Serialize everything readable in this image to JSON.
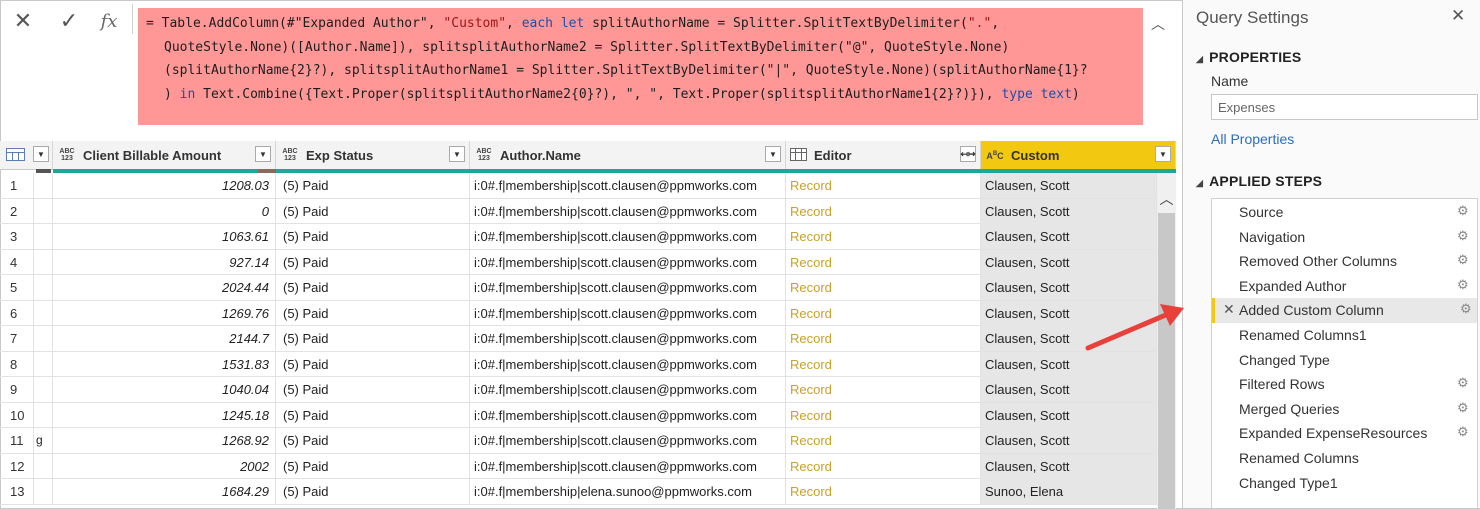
{
  "formula_bar": {
    "cancel_icon": "close-icon",
    "commit_icon": "check-icon",
    "fx_label": "fx",
    "line1_a": "= Table.AddColumn(#\"Expanded Author\", ",
    "line1_b": "\"Custom\"",
    "line1_c": ", ",
    "line1_d": "each let",
    "line1_e": " splitAuthorName = Splitter.SplitTextByDelimiter(",
    "line1_f": "\".\"",
    "line1_g": ",",
    "line2": "QuoteStyle.None)([Author.Name]), splitsplitAuthorName2 = Splitter.SplitTextByDelimiter(\"@\", QuoteStyle.None)",
    "line3": "(splitAuthorName{2}?), splitsplitAuthorName1 = Splitter.SplitTextByDelimiter(\"|\", QuoteStyle.None)(splitAuthorName{1}?",
    "line4_a": ") ",
    "line4_b": "in",
    "line4_c": " Text.Combine({Text.Proper(splitsplitAuthorName2{0}?), \", \", Text.Proper(splitsplitAuthorName1{2}?)}), ",
    "line4_d": "type text",
    "line4_e": ")",
    "bg_color": "#ff9797"
  },
  "grid": {
    "columns": [
      {
        "type_icon": "ABC\n123",
        "label": "Client Billable Amount"
      },
      {
        "type_icon": "ABC\n123",
        "label": "Exp Status"
      },
      {
        "type_icon": "ABC\n123",
        "label": "Author.Name"
      },
      {
        "type_icon": "table-icon",
        "label": "Editor"
      },
      {
        "type_icon": "ABC",
        "label": "Custom"
      }
    ],
    "rows": [
      {
        "n": "1",
        "sel": "",
        "amount": "1208.03",
        "status": "(5) Paid",
        "author": "i:0#.f|membership|scott.clausen@ppmworks.com",
        "editor": "Record",
        "custom": "Clausen, Scott"
      },
      {
        "n": "2",
        "sel": "",
        "amount": "0",
        "status": "(5) Paid",
        "author": "i:0#.f|membership|scott.clausen@ppmworks.com",
        "editor": "Record",
        "custom": "Clausen, Scott"
      },
      {
        "n": "3",
        "sel": "",
        "amount": "1063.61",
        "status": "(5) Paid",
        "author": "i:0#.f|membership|scott.clausen@ppmworks.com",
        "editor": "Record",
        "custom": "Clausen, Scott"
      },
      {
        "n": "4",
        "sel": "",
        "amount": "927.14",
        "status": "(5) Paid",
        "author": "i:0#.f|membership|scott.clausen@ppmworks.com",
        "editor": "Record",
        "custom": "Clausen, Scott"
      },
      {
        "n": "5",
        "sel": "",
        "amount": "2024.44",
        "status": "(5) Paid",
        "author": "i:0#.f|membership|scott.clausen@ppmworks.com",
        "editor": "Record",
        "custom": "Clausen, Scott"
      },
      {
        "n": "6",
        "sel": "",
        "amount": "1269.76",
        "status": "(5) Paid",
        "author": "i:0#.f|membership|scott.clausen@ppmworks.com",
        "editor": "Record",
        "custom": "Clausen, Scott"
      },
      {
        "n": "7",
        "sel": "",
        "amount": "2144.7",
        "status": "(5) Paid",
        "author": "i:0#.f|membership|scott.clausen@ppmworks.com",
        "editor": "Record",
        "custom": "Clausen, Scott"
      },
      {
        "n": "8",
        "sel": "",
        "amount": "1531.83",
        "status": "(5) Paid",
        "author": "i:0#.f|membership|scott.clausen@ppmworks.com",
        "editor": "Record",
        "custom": "Clausen, Scott"
      },
      {
        "n": "9",
        "sel": "",
        "amount": "1040.04",
        "status": "(5) Paid",
        "author": "i:0#.f|membership|scott.clausen@ppmworks.com",
        "editor": "Record",
        "custom": "Clausen, Scott"
      },
      {
        "n": "10",
        "sel": "",
        "amount": "1245.18",
        "status": "(5) Paid",
        "author": "i:0#.f|membership|scott.clausen@ppmworks.com",
        "editor": "Record",
        "custom": "Clausen, Scott"
      },
      {
        "n": "11",
        "sel": "g",
        "amount": "1268.92",
        "status": "(5) Paid",
        "author": "i:0#.f|membership|scott.clausen@ppmworks.com",
        "editor": "Record",
        "custom": "Clausen, Scott"
      },
      {
        "n": "12",
        "sel": "",
        "amount": "2002",
        "status": "(5) Paid",
        "author": "i:0#.f|membership|scott.clausen@ppmworks.com",
        "editor": "Record",
        "custom": "Clausen, Scott"
      },
      {
        "n": "13",
        "sel": "",
        "amount": "1684.29",
        "status": "(5) Paid",
        "author": "i:0#.f|membership|elena.sunoo@ppmworks.com",
        "editor": "Record",
        "custom": "Sunoo, Elena"
      }
    ]
  },
  "query_settings": {
    "title": "Query Settings",
    "properties_header": "PROPERTIES",
    "name_label": "Name",
    "name_value": "Expenses",
    "all_properties_link": "All Properties",
    "applied_steps_header": "APPLIED STEPS",
    "steps": [
      {
        "label": "Source",
        "gear": true
      },
      {
        "label": "Navigation",
        "gear": true
      },
      {
        "label": "Removed Other Columns",
        "gear": true
      },
      {
        "label": "Expanded Author",
        "gear": true
      },
      {
        "label": "Added Custom Column",
        "gear": true,
        "selected": true
      },
      {
        "label": "Renamed Columns1",
        "gear": false
      },
      {
        "label": "Changed Type",
        "gear": false
      },
      {
        "label": "Filtered Rows",
        "gear": true
      },
      {
        "label": "Merged Queries",
        "gear": true
      },
      {
        "label": "Expanded ExpenseResources",
        "gear": true
      },
      {
        "label": "Renamed Columns",
        "gear": false
      },
      {
        "label": "Changed Type1",
        "gear": false
      }
    ]
  },
  "colors": {
    "accent_custom_header": "#f2c811",
    "quality_bar": "#1ba897",
    "record_link": "#c9a227",
    "arrow": "#e8403a"
  }
}
